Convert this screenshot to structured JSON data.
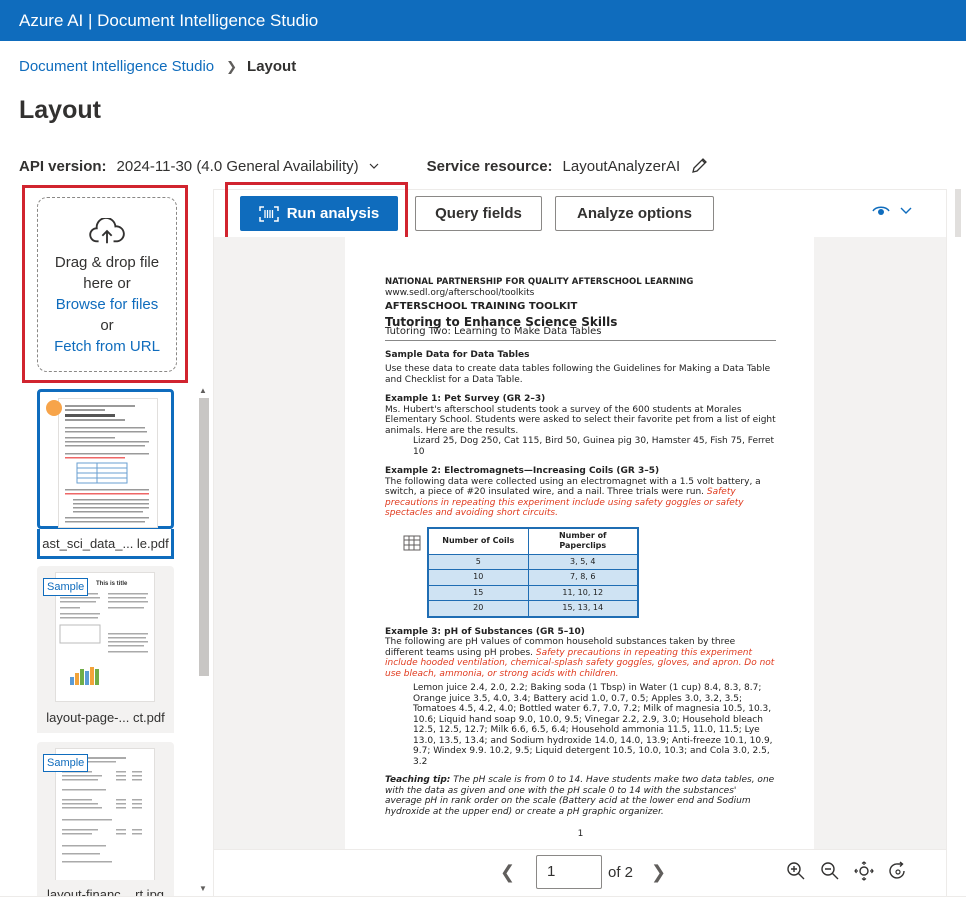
{
  "app": {
    "title": "Azure AI | Document Intelligence Studio"
  },
  "breadcrumb": {
    "root": "Document Intelligence Studio",
    "current": "Layout"
  },
  "page_title": "Layout",
  "api": {
    "label": "API version:",
    "value": "2024-11-30 (4.0 General Availability)"
  },
  "service": {
    "label": "Service resource:",
    "value": "LayoutAnalyzerAI"
  },
  "upload": {
    "line1": "Drag & drop file",
    "line2": "here or",
    "browse": "Browse for files",
    "or": "or",
    "fetch": "Fetch from URL"
  },
  "files": [
    {
      "name": "ast_sci_data_... le.pdf",
      "selected": true
    },
    {
      "name": "layout-page-... ct.pdf",
      "badge": "Sample"
    },
    {
      "name": "layout-financ... rt.jpg",
      "badge": "Sample"
    }
  ],
  "thumb2": {
    "title": "This is title"
  },
  "toolbar": {
    "run": "Run analysis",
    "query": "Query fields",
    "options": "Analyze options"
  },
  "doc": {
    "org": "NATIONAL PARTNERSHIP FOR QUALITY AFTERSCHOOL LEARNING",
    "url": "www.sedl.org/afterschool/toolkits",
    "kit": "AFTERSCHOOL TRAINING TOOLKIT",
    "heading": "Tutoring to Enhance Science Skills",
    "sub": "Tutoring Two: Learning to Make Data Tables",
    "s0": "Sample Data for Data Tables",
    "p0": "Use these data to create data tables following the Guidelines for Making a Data Table and Checklist for a Data Table.",
    "s1": "Example 1: Pet Survey (GR 2–3)",
    "p1": "Ms. Hubert's afterschool students took a survey of the 600 students at Morales Elementary School. Students were asked to select their favorite pet from a list of eight animals. Here are the results.",
    "p1b": "Lizard 25, Dog 250, Cat 115, Bird 50, Guinea pig 30, Hamster 45, Fish 75, Ferret 10",
    "s2": "Example 2: Electromagnets—Increasing Coils (GR 3–5)",
    "p2": "The following data were collected using an electromagnet with a 1.5 volt battery, a switch, a piece of #20 insulated wire, and a nail. Three trials were run.",
    "p2red": "Safety precautions in repeating this experiment include using safety goggles or safety spectacles and avoiding short circuits.",
    "table": {
      "headers": [
        "Number of Coils",
        "Number of Paperclips"
      ],
      "rows": [
        [
          "5",
          "3, 5, 4"
        ],
        [
          "10",
          "7, 8, 6"
        ],
        [
          "15",
          "11, 10, 12"
        ],
        [
          "20",
          "15, 13, 14"
        ]
      ]
    },
    "s3": "Example 3: pH of Substances (GR 5–10)",
    "p3": "The following are pH values of common household substances taken by three different teams using pH probes.",
    "p3red": "Safety precautions in repeating this experiment include hooded ventilation, chemical-splash safety goggles, gloves, and apron. Do not use bleach, ammonia, or strong acids with children.",
    "p3b": "Lemon juice 2.4, 2.0, 2.2; Baking soda (1 Tbsp) in Water (1 cup) 8.4, 8.3, 8.7; Orange juice 3.5, 4.0, 3.4; Battery acid 1.0, 0.7, 0.5; Apples 3.0, 3.2, 3.5; Tomatoes 4.5, 4.2, 4.0; Bottled water 6.7, 7.0, 7.2; Milk of magnesia 10.5, 10.3, 10.6; Liquid hand soap 9.0, 10.0, 9.5; Vinegar 2.2, 2.9, 3.0; Household bleach 12.5, 12.5, 12.7; Milk 6.6, 6.5, 6.4; Household ammonia 11.5, 11.0, 11.5; Lye 13.0, 13.5, 13.4; and Sodium hydroxide 14.0, 14.0, 13.9; Anti-freeze 10.1, 10.9, 9.7; Windex 9.9. 10.2, 9.5; Liquid detergent 10.5, 10.0, 10.3; and Cola 3.0, 2.5, 3.2",
    "tip_label": "Teaching tip:",
    "tip": "The pH scale is from 0 to 14. Have students make two data tables, one with the data as given and one with the pH scale 0 to 14 with the substances' average pH in rank order on the scale (Battery acid at the lower end and Sodium hydroxide at the upper end) or create a pH graphic organizer.",
    "page_num": "1"
  },
  "pager": {
    "current": "1",
    "of": "of 2"
  },
  "icons": {
    "upload": "cloud-upload-icon",
    "run": "barcode-scan-icon",
    "eye": "eye-icon",
    "zoom_in": "zoom-in-icon",
    "zoom_out": "zoom-out-icon",
    "fit": "fit-page-icon",
    "rotate": "rotate-icon"
  },
  "colors": {
    "brand": "#0f6cbd",
    "highlight": "#d1242f",
    "accent_dot": "#f7a44a"
  }
}
